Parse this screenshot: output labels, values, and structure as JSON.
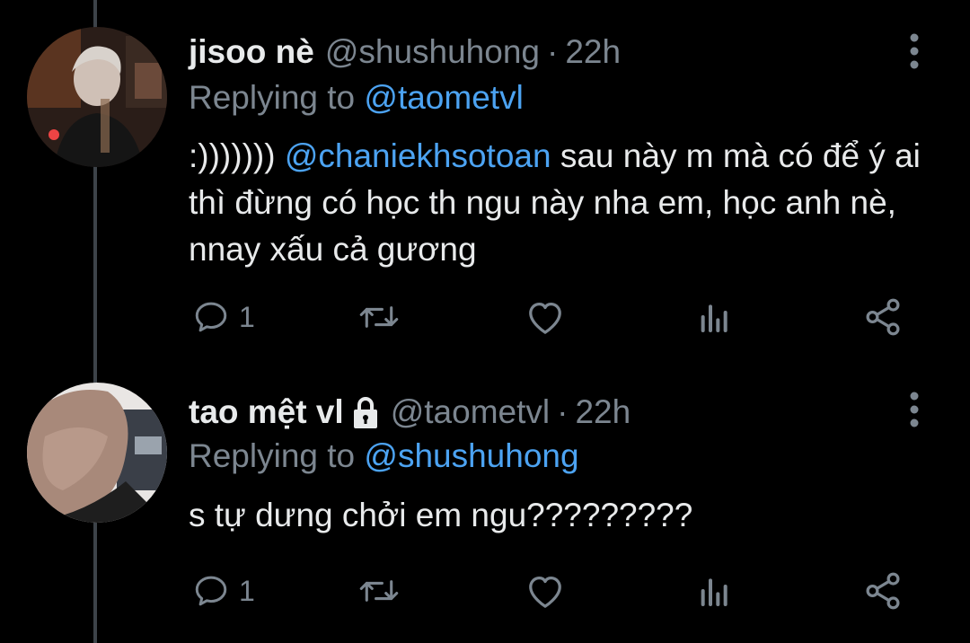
{
  "tweets": [
    {
      "name": "jisoo nè",
      "handle": "@shushuhong",
      "separator": "·",
      "time": "22h",
      "replying_prefix": "Replying to",
      "replying_to": "@taometvl",
      "text_prefix": ":))))))) ",
      "text_mention": "@chaniekhsotoan",
      "text_rest": " sau này m mà có để ý ai thì đừng có học th ngu này nha em, học anh nè, nnay xấu cả gương",
      "reply_count": "1"
    },
    {
      "name": "tao mệt vl",
      "handle": "@taometvl",
      "separator": "·",
      "time": "22h",
      "replying_prefix": "Replying to",
      "replying_to": "@shushuhong",
      "text": "s tự dưng chởi em ngu?????????",
      "reply_count": "1"
    }
  ],
  "icons": {
    "reply": "comment-bubble-icon",
    "retweet": "retweet-icon",
    "like": "heart-icon",
    "analytics": "analytics-icon",
    "share": "share-icon",
    "more": "more-vertical-icon",
    "protected": "lock-icon"
  },
  "colors": {
    "background": "#000000",
    "text": "#e8eaeb",
    "muted": "#7c8690",
    "link": "#4ca3f2",
    "thread_line": "#3d4349"
  }
}
